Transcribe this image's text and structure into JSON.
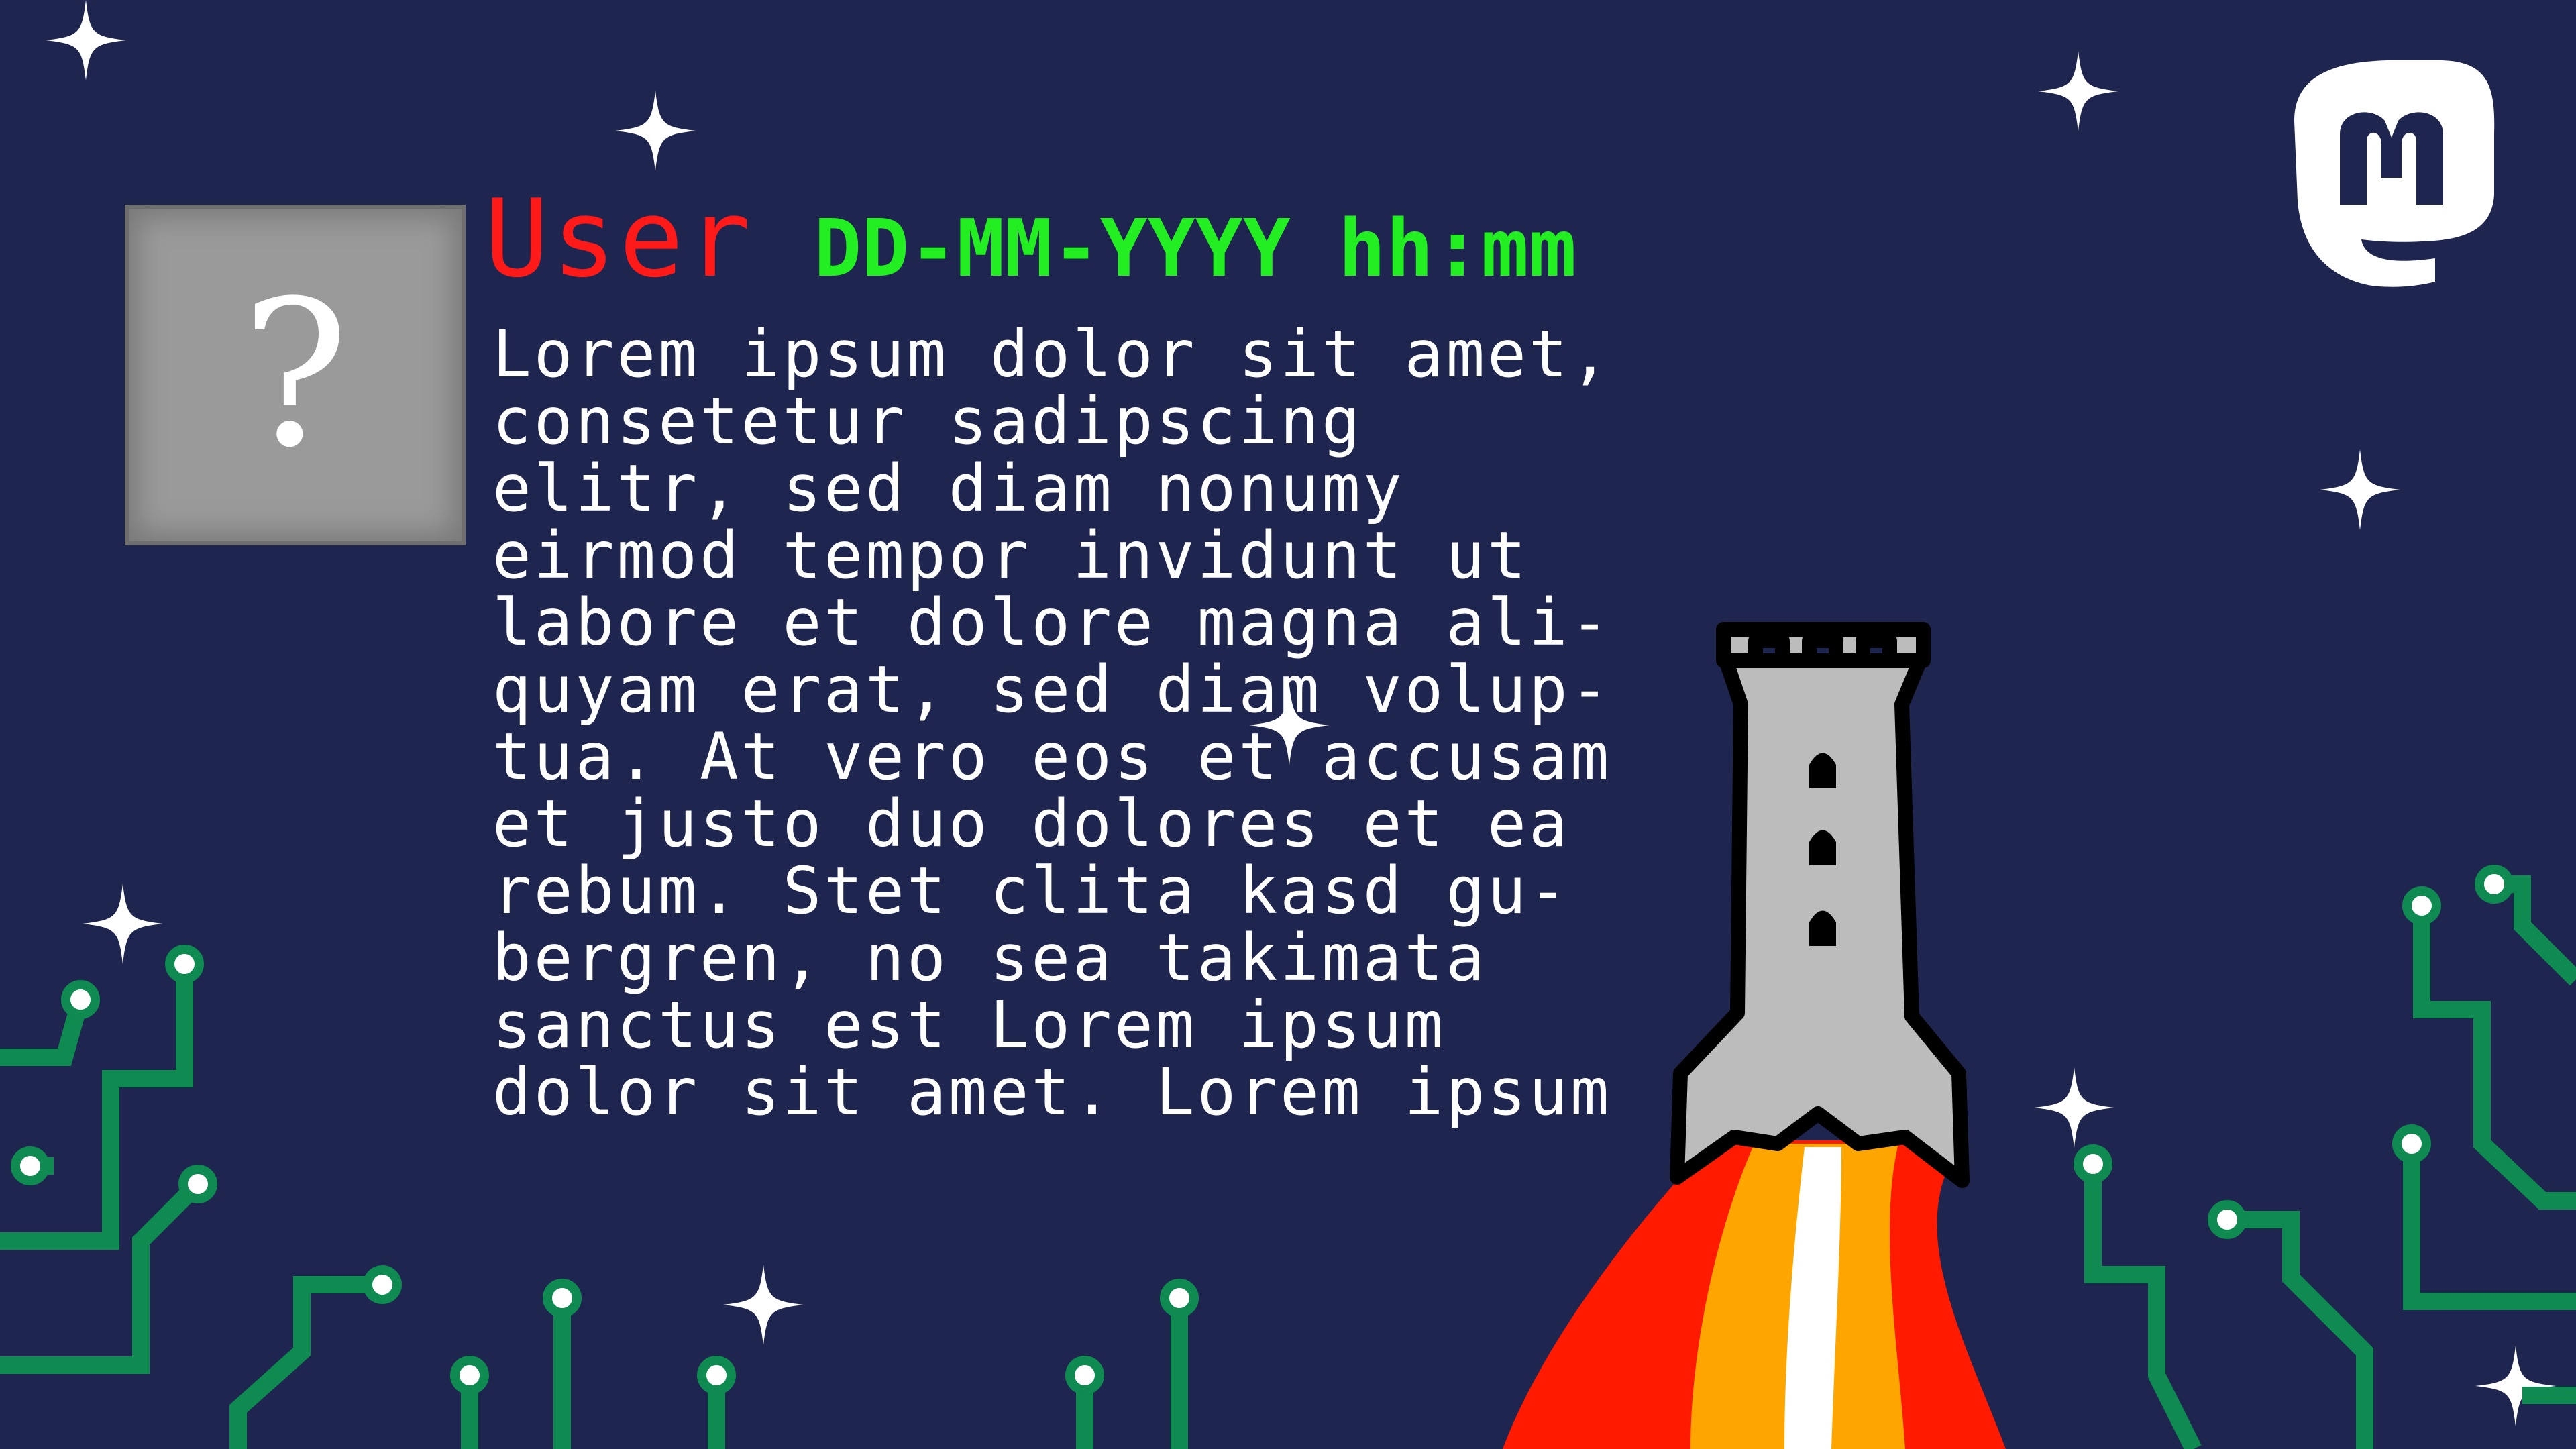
{
  "post": {
    "user": "User",
    "datetime": "DD-MM-YYYY hh:mm",
    "lines": [
      "Lorem ipsum dolor sit amet,",
      "consetetur sadipscing",
      "elitr, sed diam nonumy",
      "eirmod tempor invidunt ut",
      "labore et dolore magna ali-",
      "quyam erat, sed diam volup-",
      "tua. At vero eos et accusam",
      "et justo duo dolores et ea",
      "rebum. Stet clita kasd gu-",
      "bergren, no sea takimata",
      "sanctus est Lorem ipsum",
      "dolor sit amet. Lorem ipsum"
    ]
  },
  "avatar": {
    "placeholder": "?"
  },
  "icons": [
    "mastodon-logo-icon",
    "rocket-tower-icon",
    "star-icon",
    "circuit-trace-icon"
  ],
  "colors": {
    "background": "#1e2650",
    "user": "#ff1a1a",
    "datetime": "#22ee22",
    "text": "#ffffff",
    "circuit": "#0f8a50",
    "rocket_body": "#bcbcbc",
    "flame_red": "#ff1a00",
    "flame_orange": "#ffa500",
    "flame_white": "#ffffff"
  }
}
